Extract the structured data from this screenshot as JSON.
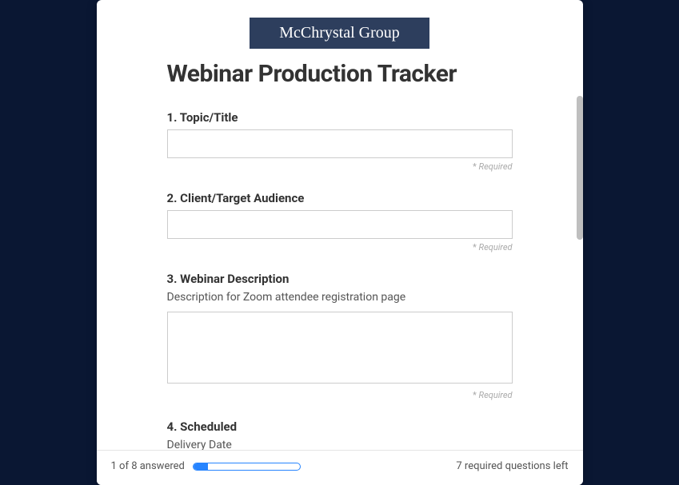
{
  "brand": "McChrystal Group",
  "title": "Webinar Production Tracker",
  "questions": {
    "q1": {
      "label": "1. Topic/Title",
      "required_text": "Required",
      "value": ""
    },
    "q2": {
      "label": "2. Client/Target Audience",
      "required_text": "Required",
      "value": ""
    },
    "q3": {
      "label": "3. Webinar Description",
      "sublabel": "Description for Zoom attendee registration page",
      "required_text": "Required",
      "value": ""
    },
    "q4": {
      "label": "4. Scheduled",
      "sublabel": "Delivery Date"
    }
  },
  "footer": {
    "answered_text": "1 of 8 answered",
    "remaining_text": "7 required questions left",
    "progress_pct": 14
  }
}
